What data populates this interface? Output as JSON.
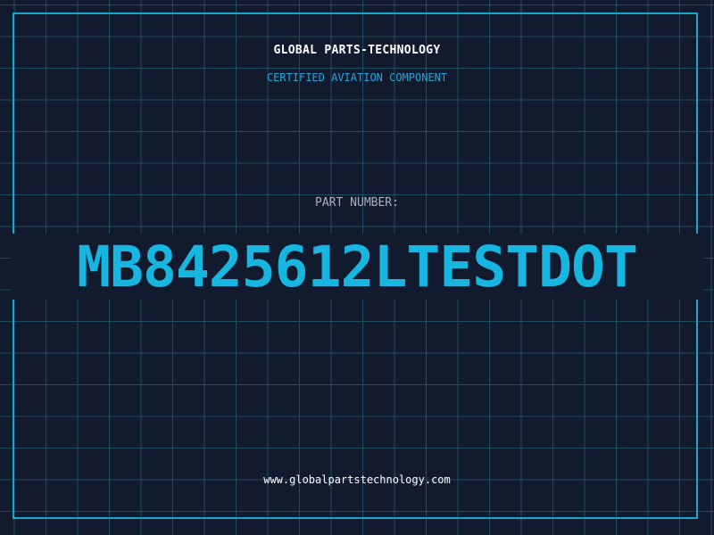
{
  "header": {
    "brand": "GLOBAL PARTS-TECHNOLOGY",
    "subtitle": "CERTIFIED AVIATION COMPONENT"
  },
  "part": {
    "label": "PART NUMBER:",
    "number": "MB8425612LTESTDOT"
  },
  "footer": {
    "website": "www.globalpartstechnology.com"
  },
  "colors": {
    "background": "#121a2e",
    "grid": "#1f4a63",
    "accent": "#16b6e0",
    "frame": "#1aa6c8"
  }
}
